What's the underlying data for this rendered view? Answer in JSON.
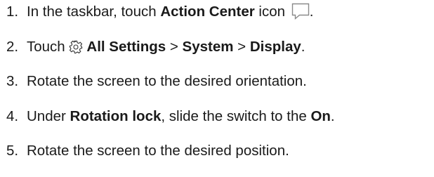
{
  "steps": [
    {
      "number": "1.",
      "text_1": "In the taskbar, touch ",
      "bold_1": "Action Center",
      "text_2": " icon ",
      "icon": "action-center-icon",
      "text_3": "."
    },
    {
      "number": "2.",
      "text_1": "Touch ",
      "icon": "gear-icon",
      "bold_1": "All Settings",
      "text_2": " > ",
      "bold_2": "System",
      "text_3": " > ",
      "bold_3": "Display",
      "text_4": "."
    },
    {
      "number": "3.",
      "text_1": "Rotate the screen to the desired orientation."
    },
    {
      "number": "4.",
      "text_1": "Under ",
      "bold_1": "Rotation lock",
      "text_2": ", slide the switch to the ",
      "bold_2": "On",
      "text_3": "."
    },
    {
      "number": "5.",
      "text_1": "Rotate the screen to the desired position."
    }
  ]
}
